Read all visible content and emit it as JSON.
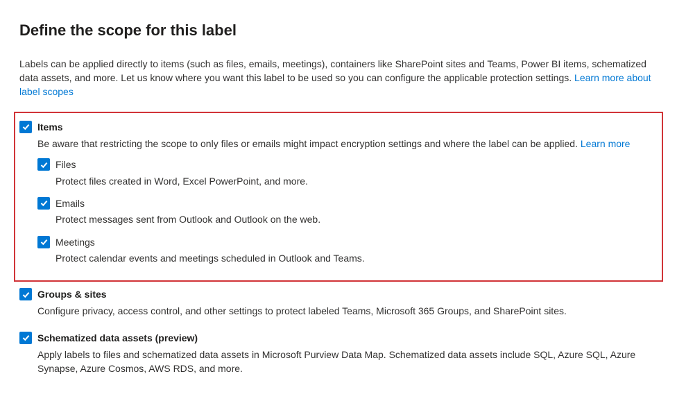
{
  "title": "Define the scope for this label",
  "intro": {
    "text": "Labels can be applied directly to items (such as files, emails, meetings), containers like SharePoint sites and Teams, Power BI items, schematized data assets, and more. Let us know where you want this label to be used so you can configure the applicable protection settings. ",
    "link": "Learn more about label scopes"
  },
  "options": {
    "items": {
      "label": "Items",
      "checked": true,
      "desc": "Be aware that restricting the scope to only files or emails might impact encryption settings and where the label can be applied. ",
      "link": "Learn more",
      "sub": {
        "files": {
          "label": "Files",
          "checked": true,
          "desc": "Protect files created in Word, Excel PowerPoint, and more."
        },
        "emails": {
          "label": "Emails",
          "checked": true,
          "desc": "Protect messages sent from Outlook and Outlook on the web."
        },
        "meetings": {
          "label": "Meetings",
          "checked": true,
          "desc": "Protect calendar events and meetings scheduled in Outlook and Teams."
        }
      }
    },
    "groups": {
      "label": "Groups & sites",
      "checked": true,
      "desc": "Configure privacy, access control, and other settings to protect labeled Teams, Microsoft 365 Groups, and SharePoint sites."
    },
    "schematized": {
      "label": "Schematized data assets (preview)",
      "checked": true,
      "desc": "Apply labels to files and schematized data assets in Microsoft Purview Data Map. Schematized data assets include SQL, Azure SQL, Azure Synapse, Azure Cosmos, AWS RDS, and more."
    }
  }
}
